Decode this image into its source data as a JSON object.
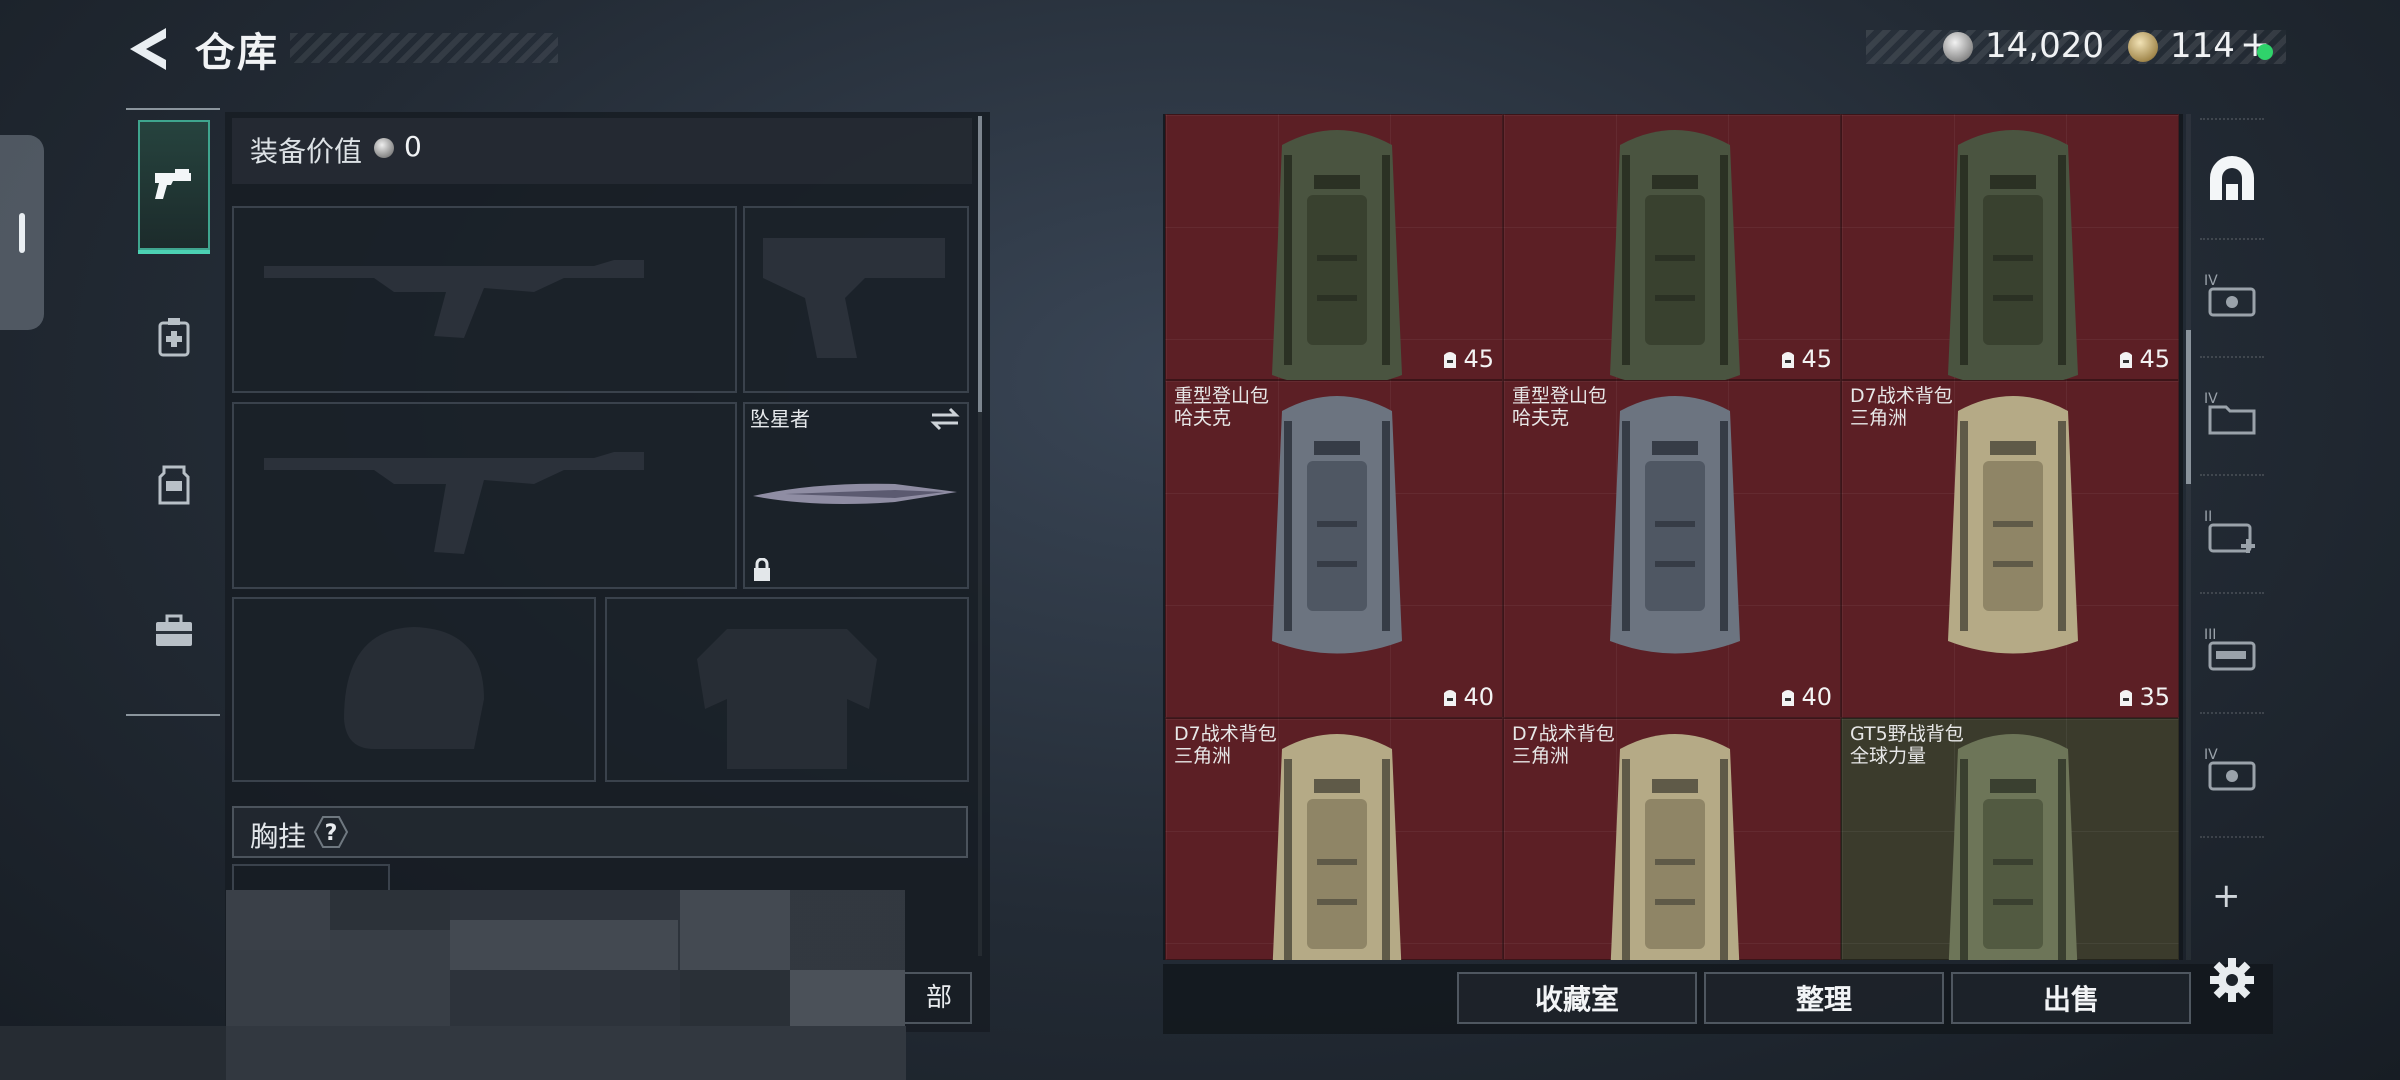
{
  "header": {
    "title": "仓库",
    "currency": {
      "silver": "14,020",
      "gold": "114",
      "plus_label": "+",
      "silver_icon": "silver-coin-icon",
      "gold_icon": "gold-coin-icon",
      "online_color": "#2fd36b"
    }
  },
  "rail": {
    "items": [
      {
        "name": "weapons",
        "icon": "pistol-icon",
        "active": true
      },
      {
        "name": "medical",
        "icon": "medkit-icon"
      },
      {
        "name": "armor",
        "icon": "vest-icon"
      },
      {
        "name": "tools",
        "icon": "toolbox-icon"
      }
    ]
  },
  "loadout": {
    "equip_value_label": "装备价值",
    "equip_value": "0",
    "melee_name": "坠星者",
    "chest_label": "胸挂",
    "chest_help": "?",
    "button_label": "部"
  },
  "stash": {
    "items": [
      {
        "line1": "",
        "line2": "",
        "capacity": "45",
        "type": "green-pack"
      },
      {
        "line1": "",
        "line2": "",
        "capacity": "45",
        "type": "green-pack"
      },
      {
        "line1": "",
        "line2": "",
        "capacity": "45",
        "type": "green-pack"
      },
      {
        "line1": "重型登山包",
        "line2": "哈夫克",
        "capacity": "40",
        "type": "grey-pack"
      },
      {
        "line1": "重型登山包",
        "line2": "哈夫克",
        "capacity": "40",
        "type": "grey-pack"
      },
      {
        "line1": "D7战术背包",
        "line2": "三角洲",
        "capacity": "35",
        "type": "tan-pack"
      },
      {
        "line1": "D7战术背包",
        "line2": "三角洲",
        "capacity": "",
        "type": "tan-pack"
      },
      {
        "line1": "D7战术背包",
        "line2": "三角洲",
        "capacity": "",
        "type": "tan-pack"
      },
      {
        "line1": "GT5野战背包",
        "line2": "全球力量",
        "capacity": "",
        "type": "field-pack"
      }
    ],
    "rarity_colors": {
      "red": "#5c1f25",
      "olive": "#3b3b2c"
    }
  },
  "filters": {
    "items": [
      {
        "icon": "stash-home-icon",
        "label": ""
      },
      {
        "icon": "gear-case-icon",
        "label": "IV"
      },
      {
        "icon": "folder-case-icon",
        "label": "IV"
      },
      {
        "icon": "medical-case-icon",
        "label": "II"
      },
      {
        "icon": "ammo-case-icon",
        "label": "III"
      },
      {
        "icon": "gear-case-icon",
        "label": "IV"
      }
    ],
    "add_label": "+"
  },
  "actions": {
    "collection_label": "收藏室",
    "sort_label": "整理",
    "sell_label": "出售"
  }
}
